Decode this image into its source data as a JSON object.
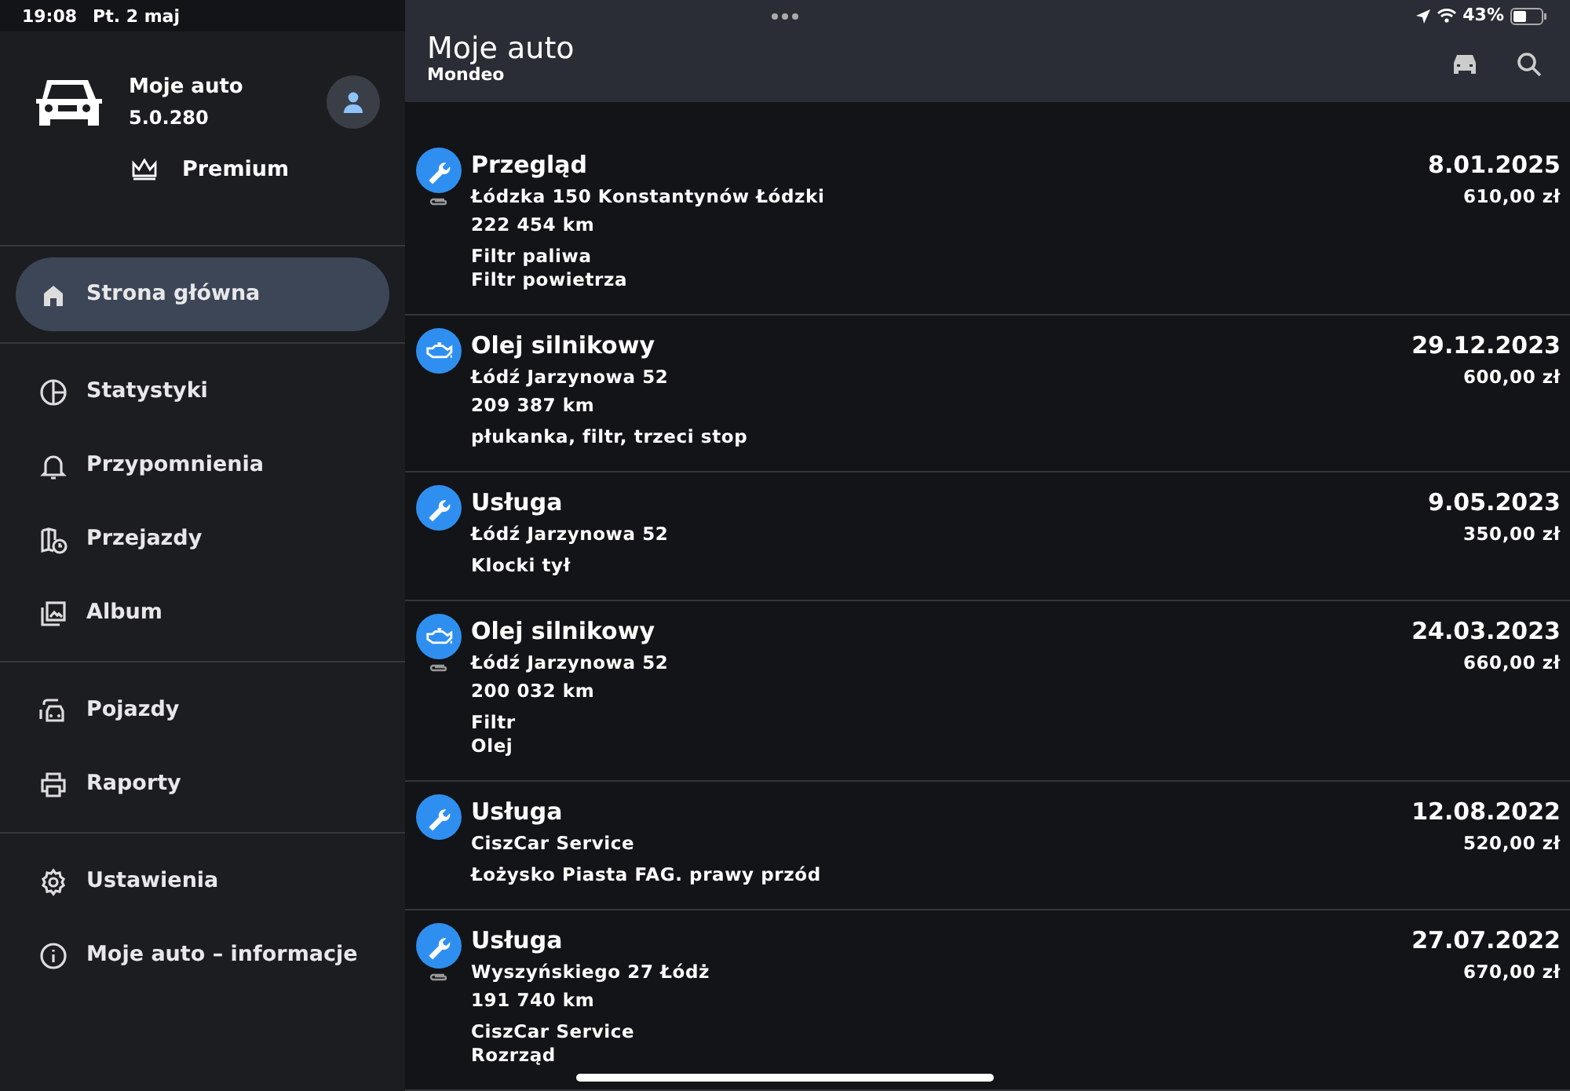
{
  "status_bar": {
    "time": "19:08",
    "date": "Pt. 2 maj",
    "battery": "43%"
  },
  "sidebar": {
    "app_name": "Moje auto",
    "version": "5.0.280",
    "plan": "Premium",
    "groups": [
      [
        {
          "label": "Strona główna",
          "selected": true
        }
      ],
      [
        {
          "label": "Statystyki",
          "selected": false
        },
        {
          "label": "Przypomnienia",
          "selected": false
        },
        {
          "label": "Przejazdy",
          "selected": false
        },
        {
          "label": "Album",
          "selected": false
        }
      ],
      [
        {
          "label": "Pojazdy",
          "selected": false
        },
        {
          "label": "Raporty",
          "selected": false
        }
      ],
      [
        {
          "label": "Ustawienia",
          "selected": false
        },
        {
          "label": "Moje auto – informacje",
          "selected": false
        }
      ]
    ]
  },
  "header": {
    "title": "Moje auto",
    "subtitle": "Mondeo"
  },
  "entries": [
    {
      "kind": "service",
      "attachment": true,
      "title": "Przegląd",
      "date": "8.01.2025",
      "cost": "610,00 zł",
      "place": "Łódzka 150 Konstantynów Łódzki",
      "mileage": "222 454 km",
      "notes": [
        "Filtr paliwa",
        "Filtr powietrza"
      ]
    },
    {
      "kind": "oil",
      "attachment": false,
      "title": "Olej silnikowy",
      "date": "29.12.2023",
      "cost": "600,00 zł",
      "place": "Łódź Jarzynowa 52",
      "mileage": "209 387 km",
      "notes": [
        "płukanka, filtr, trzeci stop"
      ]
    },
    {
      "kind": "service",
      "attachment": false,
      "title": "Usługa",
      "date": "9.05.2023",
      "cost": "350,00 zł",
      "place": "Łódź Jarzynowa 52",
      "notes": [
        "Klocki tył"
      ]
    },
    {
      "kind": "oil",
      "attachment": true,
      "title": "Olej silnikowy",
      "date": "24.03.2023",
      "cost": "660,00 zł",
      "place": "Łódź Jarzynowa 52",
      "mileage": "200 032 km",
      "notes": [
        "Filtr",
        "Olej"
      ]
    },
    {
      "kind": "service",
      "attachment": false,
      "title": "Usługa",
      "date": "12.08.2022",
      "cost": "520,00 zł",
      "place": "CiszCar Service",
      "notes": [
        "Łożysko Piasta FAG. prawy przód"
      ]
    },
    {
      "kind": "service",
      "attachment": true,
      "title": "Usługa",
      "date": "27.07.2022",
      "cost": "670,00 zł",
      "place": "Wyszyńskiego 27 Łódż",
      "mileage": "191 740 km",
      "notes": [
        "CiszCar Service",
        "Rozrząd"
      ]
    }
  ]
}
